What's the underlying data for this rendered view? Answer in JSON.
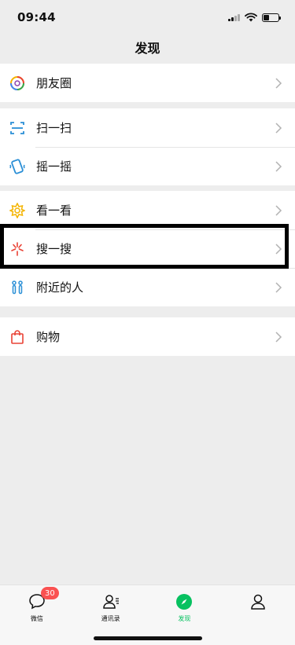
{
  "status_bar": {
    "time": "09:44"
  },
  "header": {
    "title": "发现"
  },
  "groups": [
    {
      "items": [
        {
          "label": "朋友圈",
          "icon": "moments-icon"
        }
      ]
    },
    {
      "items": [
        {
          "label": "扫一扫",
          "icon": "scan-icon"
        },
        {
          "label": "摇一摇",
          "icon": "shake-icon"
        }
      ]
    },
    {
      "items": [
        {
          "label": "看一看",
          "icon": "top-stories-icon"
        },
        {
          "label": "搜一搜",
          "icon": "search-icon"
        },
        {
          "label": "附近的人",
          "icon": "people-nearby-icon"
        }
      ]
    },
    {
      "items": [
        {
          "label": "购物",
          "icon": "shopping-bag-icon"
        }
      ]
    }
  ],
  "tab_bar": {
    "tabs": [
      {
        "label": "微信",
        "icon": "chat-bubble-icon",
        "badge": "30"
      },
      {
        "label": "通讯录",
        "icon": "contacts-icon"
      },
      {
        "label": "发现",
        "icon": "compass-icon",
        "active": true
      },
      {
        "label": "",
        "icon": "profile-icon"
      }
    ]
  },
  "colors": {
    "accent": "#07c160",
    "badge": "#fa5151",
    "background": "#ededed"
  }
}
